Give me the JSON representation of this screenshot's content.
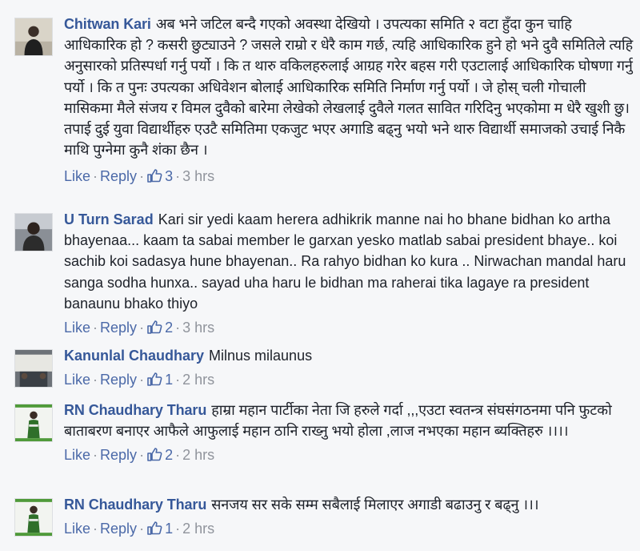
{
  "comments": [
    {
      "author": "Chitwan Kari",
      "text": "अब भने जटिल बन्दै गएको अवस्था देखियो । उपत्यका समिति २ वटा हुँदा कुन चाहि आधिकारिक हो ? कसरी छुट्याउने ? जसले राम्रो र धेरै काम गर्छ, त्यहि आधिकारिक हुने हो भने दुवै समितिले त्यहि अनुसारको प्रतिस्पर्धा गर्नु पर्यो । कि त थारु वकिलहरुलाई आग्रह गरेर बहस गरी एउटालाई आधिकारिक घोषणा गर्नु पर्यो । कि त पुनः उपत्यका अधिवेशन बोलाई आधिकारिक समिति निर्माण गर्नु पर्यो । जे होस् चली गोचाली मासिकमा मैले संजय र विमल दुवैको बारेमा लेखेको लेखलाई दुवैले गलत सावित गरिदिनु भएकोमा म धेरै खुशी छु। तपाई दुई युवा विद्यार्थीहरु एउटै समितिमा एकजुट भएर अगाडि बढ्नु भयो भने थारु विद्यार्थी समाजको उचाई निकै माथि पुग्नेमा कुनै शंका छैन ।",
      "like": "Like",
      "reply": "Reply",
      "likes": "3",
      "time": "3 hrs"
    },
    {
      "author": "U Turn Sarad",
      "text": "Kari sir yedi kaam herera adhikrik manne nai ho bhane bidhan ko artha bhayenaa... kaam ta sabai member le garxan yesko matlab sabai president bhaye.. koi sachib koi sadasya hune bhayenan.. Ra rahyo bidhan ko kura .. Nirwachan mandal haru sanga sodha hunxa.. sayad uha haru le bidhan ma raherai tika lagaye ra president banaunu bhako thiyo",
      "like": "Like",
      "reply": "Reply",
      "likes": "2",
      "time": "3 hrs"
    },
    {
      "author": "Kanunlal Chaudhary",
      "text": "Milnus milaunus",
      "like": "Like",
      "reply": "Reply",
      "likes": "1",
      "time": "2 hrs"
    },
    {
      "author": "RN Chaudhary Tharu",
      "text": "हाम्रा महान पार्टीका नेता जि हरुले गर्दा ,,,एउटा स्वतन्त्र संघसंगठनमा पनि फुटको बाताबरण बनाएर आफैले आफुलाई महान ठानि राख्नु भयो होला ,लाज नभएका महान ब्यक्तिहरु ।।।।",
      "like": "Like",
      "reply": "Reply",
      "likes": "2",
      "time": "2 hrs"
    },
    {
      "author": "RN Chaudhary Tharu",
      "text": "सनजय सर सके सम्म सबैलाई मिलाएर अगाडी बढाउनु र बढ्नु ।।।",
      "like": "Like",
      "reply": "Reply",
      "likes": "1",
      "time": "2 hrs"
    }
  ],
  "icons": {
    "like": "thumbs-up-icon",
    "accent": "#4b69a8",
    "name_color": "#365899",
    "meta_color": "#90949c"
  }
}
